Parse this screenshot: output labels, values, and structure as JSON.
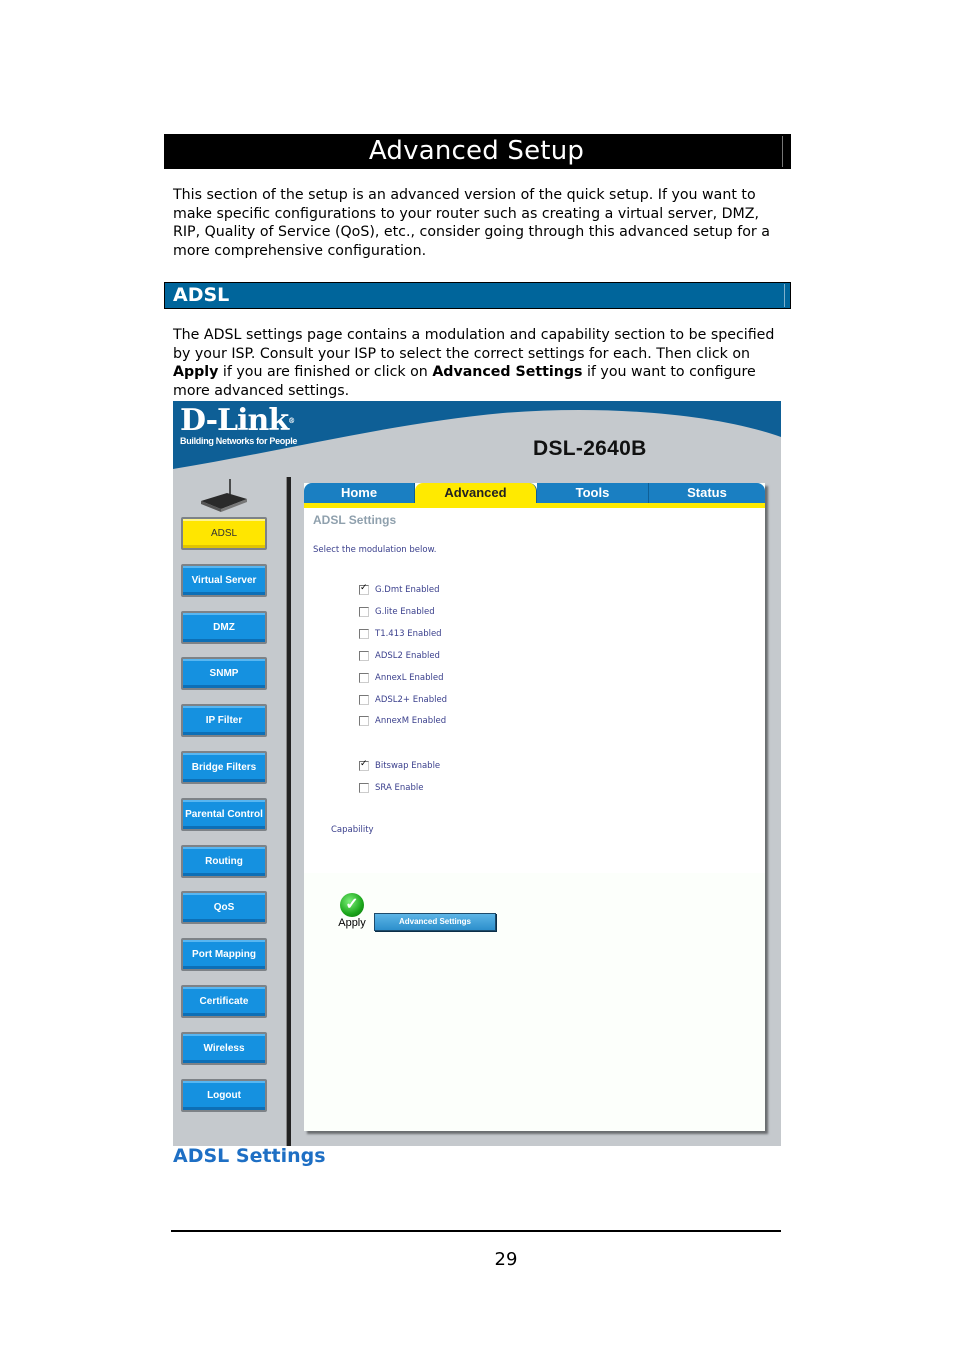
{
  "page": {
    "title": "Advanced Setup",
    "intro": "This section of the setup is an advanced version of the quick setup. If you want to make specific configurations to your router such as creating a virtual server, DMZ, RIP, Quality of Service (QoS), etc., consider going through this advanced setup for a more comprehensive configuration.",
    "section_title": "ADSL",
    "section_text_1": "The ADSL settings page contains a modulation and capability section to be specified by your ISP. Consult your ISP to select the correct settings for each. Then click on ",
    "section_bold_1": "Apply",
    "section_text_2": " if you are finished or click on ",
    "section_bold_2": "Advanced Settings",
    "section_text_3": " if you want to configure more advanced settings.",
    "figure_caption": "ADSL Settings",
    "page_number": "29"
  },
  "router_ui": {
    "brand": "D-Link",
    "brand_mark": "®",
    "tagline": "Building Networks for People",
    "model": "DSL-2640B",
    "colors": {
      "banner_blue": "#0e5f96",
      "active_yellow": "#ffe600",
      "button_blue": "#1591e0"
    },
    "sidebar": [
      {
        "label": "ADSL",
        "active": true
      },
      {
        "label": "Virtual Server",
        "active": false
      },
      {
        "label": "DMZ",
        "active": false
      },
      {
        "label": "SNMP",
        "active": false
      },
      {
        "label": "IP Filter",
        "active": false
      },
      {
        "label": "Bridge Filters",
        "active": false
      },
      {
        "label": "Parental Control",
        "active": false
      },
      {
        "label": "Routing",
        "active": false
      },
      {
        "label": "QoS",
        "active": false
      },
      {
        "label": "Port Mapping",
        "active": false
      },
      {
        "label": "Certificate",
        "active": false
      },
      {
        "label": "Wireless",
        "active": false
      },
      {
        "label": "Logout",
        "active": false
      }
    ],
    "tabs": [
      {
        "label": "Home",
        "active": false
      },
      {
        "label": "Advanced",
        "active": true
      },
      {
        "label": "Tools",
        "active": false
      },
      {
        "label": "Status",
        "active": false
      }
    ],
    "panel_title": "ADSL Settings",
    "instruction": "Select the modulation below.",
    "modulation_options": [
      {
        "label": "G.Dmt Enabled",
        "checked": true
      },
      {
        "label": "G.lite Enabled",
        "checked": false
      },
      {
        "label": "T1.413 Enabled",
        "checked": false
      },
      {
        "label": "ADSL2 Enabled",
        "checked": false
      },
      {
        "label": "AnnexL Enabled",
        "checked": false
      },
      {
        "label": "ADSL2+ Enabled",
        "checked": false
      },
      {
        "label": "AnnexM Enabled",
        "checked": false
      }
    ],
    "capability_label": "Capability",
    "capability_options": [
      {
        "label": "Bitswap Enable",
        "checked": true
      },
      {
        "label": "SRA Enable",
        "checked": false
      }
    ],
    "apply_label": "Apply",
    "apply_icon": "checkmark-icon",
    "advanced_button_label": "Advanced Settings"
  }
}
